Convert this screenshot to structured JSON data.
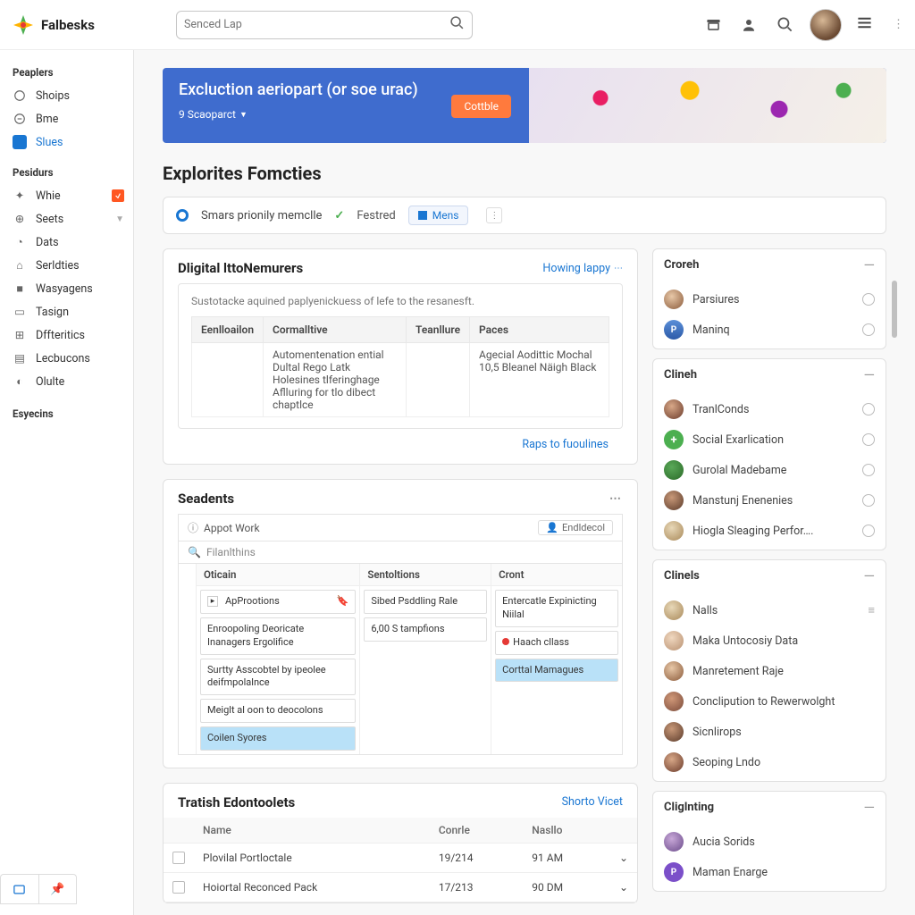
{
  "brand": "Falbesks",
  "search_placeholder": "Senced Lap",
  "sidebar": {
    "sec1": "Peaplers",
    "items1": [
      {
        "label": "Shoips"
      },
      {
        "label": "Bme"
      },
      {
        "label": "Slues",
        "active": true
      }
    ],
    "sec2": "Pesidurs",
    "items2": [
      {
        "label": "Whie",
        "badge": true
      },
      {
        "label": "Seets",
        "chev": true
      },
      {
        "label": "Dats"
      },
      {
        "label": "Serldties"
      },
      {
        "label": "Wasyagens"
      },
      {
        "label": "Tasign"
      },
      {
        "label": "Dffteritics"
      },
      {
        "label": "Lecbucons"
      },
      {
        "label": "Olulte"
      }
    ],
    "sec3": "Esyecins"
  },
  "banner": {
    "title": "Excluction aeriopart (or soe urac)",
    "sub": "9 Scaoparct",
    "btn": "Cottble"
  },
  "page_title": "Explorites Fomcties",
  "filters": {
    "opt1": "Smars prionily memclle",
    "opt2": "Festred",
    "pill": "Mens"
  },
  "digital": {
    "title": "Dligital lttoNemurers",
    "link": "Howing Iappy",
    "desc": "Sustotacke aquined paplyenickuess of lefe to the resanesft.",
    "cols": [
      "Eenlloailon",
      "Cormalltive",
      "Teanllure",
      "Paces"
    ],
    "row": {
      "c2": "Automentenation ential Dultal Rego Latk Holesines tlferinghage Aflluring for tlo dibect chaptlce",
      "c4": "Agecial Aodittic Mochal 10,5 Bleanel Näigh Black"
    },
    "refs": "Raps to fuoulines"
  },
  "seadents": {
    "title": "Seadents",
    "appot": "Appot Work",
    "chip": "Endldecol",
    "filter": "Filanlthins",
    "cols": [
      "Oticain",
      "Sentoltions",
      "Cront"
    ],
    "k1": [
      "ApProotions",
      "Enroopoling Deoricate Inanagers Ergolifice",
      "Surtty Asscobtel by ipeolee deifmpolalnce",
      "Meiglt al oon to deocolons",
      "Coilen Syores"
    ],
    "k2": [
      "Sibed Psddling Rale",
      "6,00 S tampfions"
    ],
    "k3": [
      "Entercatle Expinicting Niilal",
      "Haach cllass",
      "Corttal Mamagues"
    ]
  },
  "tlist": {
    "title": "Tratish Edontoolets",
    "link": "Shorto Vicet",
    "cols": [
      "Name",
      "Conrle",
      "Nasllo"
    ],
    "rows": [
      {
        "n": "Plovilal Portloctale",
        "c": "19/214",
        "t": "91 AM"
      },
      {
        "n": "Hoiortal Reconced Pack",
        "c": "17/213",
        "t": "90 DM"
      }
    ]
  },
  "rcol": {
    "g1": {
      "h": "Croreh",
      "items": [
        "Parsiures",
        "Maninq"
      ]
    },
    "g2": {
      "h": "Clineh",
      "items": [
        "TranlConds",
        "Social Exarlication",
        "Gurolal Madebame",
        "Manstunj Enenenies",
        "Hiogla Sleaging Perfor…."
      ]
    },
    "g3": {
      "h": "Clinels",
      "items": [
        "Nalls",
        "Maka Untocosiy Data",
        "Manretement Raje",
        "Conclipution to Rewerwolght",
        "Sicnlirops",
        "Seoping Lndo"
      ]
    },
    "g4": {
      "h": "Cliglnting",
      "items": [
        "Aucia Sorids",
        "Maman Enarge"
      ]
    }
  }
}
